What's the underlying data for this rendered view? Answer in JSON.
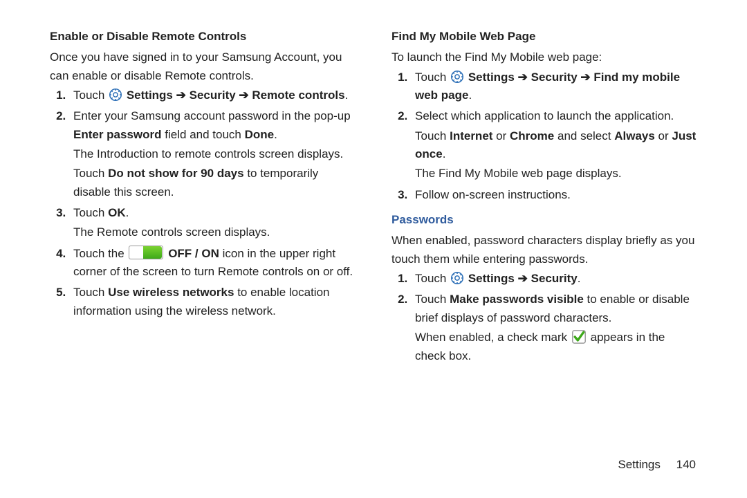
{
  "left": {
    "heading": "Enable or Disable Remote Controls",
    "intro": "Once you have signed in to your Samsung Account, you can enable or disable Remote controls.",
    "s1_touch": "Touch ",
    "s1_settings": " Settings ",
    "s1_security": " Security ",
    "s1_remote": " Remote controls",
    "s2a": "Enter your Samsung account password in the pop-up ",
    "s2b": "Enter password",
    "s2c": " field and touch ",
    "s2d": "Done",
    "s2sub1": "The Introduction to remote controls screen displays.",
    "s2sub2a": "Touch ",
    "s2sub2b": "Do not show for 90 days",
    "s2sub2c": " to temporarily disable this screen.",
    "s3a": "Touch ",
    "s3b": "OK",
    "s3sub": "The Remote controls screen displays.",
    "s4a": "Touch the ",
    "s4b": " OFF / ON",
    "s4c": " icon in the upper right corner of the screen to turn Remote controls on or off.",
    "s5a": "Touch ",
    "s5b": "Use wireless networks",
    "s5c": " to enable location information using the wireless network."
  },
  "right": {
    "heading": "Find My Mobile Web Page",
    "intro": "To launch the Find My Mobile web page:",
    "s1_touch": "Touch ",
    "s1_settings": " Settings ",
    "s1_security": " Security ",
    "s1_fmm": " Find my mobile web page",
    "s2a": "Select which application to launch the application.",
    "s2sub_a": "Touch ",
    "s2sub_b": "Internet",
    "s2sub_c": " or ",
    "s2sub_d": "Chrome",
    "s2sub_e": " and select ",
    "s2sub_f": "Always",
    "s2sub_g": " or ",
    "s2sub_h": "Just once",
    "s2sub2": "The Find My Mobile web page displays.",
    "s3": "Follow on-screen instructions.",
    "pw_heading": "Passwords",
    "pw_intro": "When enabled, password characters display briefly as you touch them while entering passwords.",
    "pw1a": "Touch ",
    "pw1b": " Settings ",
    "pw1c": " Security",
    "pw2a": "Touch ",
    "pw2b": "Make passwords visible",
    "pw2c": " to enable or disable brief displays of password characters.",
    "pw2sub_a": "When enabled, a check mark ",
    "pw2sub_b": " appears in the check box."
  },
  "footer": {
    "section": "Settings",
    "page": "140"
  },
  "arrow": "➔",
  "period": "."
}
